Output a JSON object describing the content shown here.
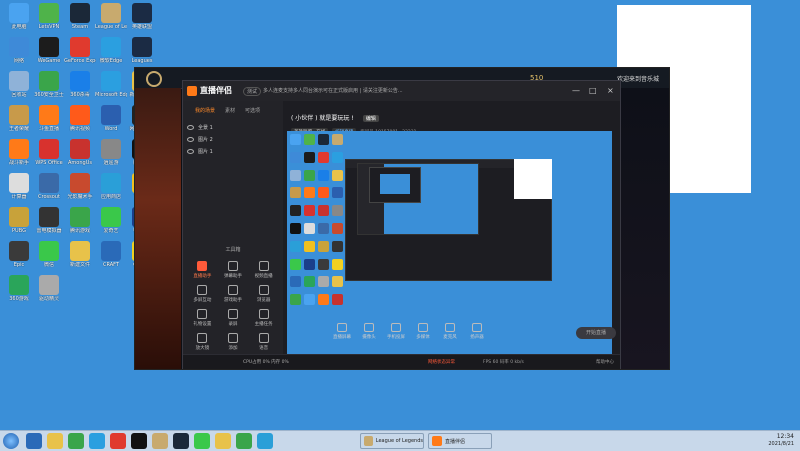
{
  "desktop": {
    "icons": [
      {
        "label": "此电脑",
        "color": "#4aa3f0"
      },
      {
        "label": "LetsVPN",
        "color": "#4fb34a"
      },
      {
        "label": "Steam",
        "color": "#1b2838"
      },
      {
        "label": "League of Legends",
        "color": "#c8aa6e"
      },
      {
        "label": "英雄联盟",
        "color": "#1b2b44"
      },
      {
        "label": "网络",
        "color": "#3e8ad8"
      },
      {
        "label": "WeGame",
        "color": "#1c1c1c"
      },
      {
        "label": "GeForce Experience",
        "color": "#e03a2e"
      },
      {
        "label": "微软Edge",
        "color": "#2b9fe0"
      },
      {
        "label": "Leagues",
        "color": "#1b2b44"
      },
      {
        "label": "回收站",
        "color": "#8fb2d8"
      },
      {
        "label": "360安全卫士",
        "color": "#3aa54a"
      },
      {
        "label": "360杀毒",
        "color": "#1a7fe8"
      },
      {
        "label": "Microsoft Edge",
        "color": "#2b9fe0"
      },
      {
        "label": "新建文件夹",
        "color": "#e8c24a"
      },
      {
        "label": "王者荣耀",
        "color": "#c89a4a"
      },
      {
        "label": "斗鱼直播",
        "color": "#ff7a18"
      },
      {
        "label": "腾讯视频",
        "color": "#ff5a1a"
      },
      {
        "label": "Word",
        "color": "#2b5faf"
      },
      {
        "label": "网易云游戏",
        "color": "#222222"
      },
      {
        "label": "战斗新手",
        "color": "#ff7a18"
      },
      {
        "label": "WPS Office",
        "color": "#d8322e"
      },
      {
        "label": "AmongUs",
        "color": "#c8322e"
      },
      {
        "label": "逍遥游",
        "color": "#888888"
      },
      {
        "label": "腾讯QQ",
        "color": "#111111"
      },
      {
        "label": "计算器",
        "color": "#dddddd"
      },
      {
        "label": "Crossout",
        "color": "#3a6aa8"
      },
      {
        "label": "光影魔术手",
        "color": "#c84a2e"
      },
      {
        "label": "应用商店",
        "color": "#2a9fd8"
      },
      {
        "label": "YY直播",
        "color": "#f0c020"
      },
      {
        "label": "PUBG",
        "color": "#c8a23a"
      },
      {
        "label": "雷电模拟器",
        "color": "#333333"
      },
      {
        "label": "腾讯游戏",
        "color": "#3aa54a"
      },
      {
        "label": "爱奇艺",
        "color": "#3ac84a"
      },
      {
        "label": "Ubisoft",
        "color": "#1a3f8a"
      },
      {
        "label": "Epic",
        "color": "#3a3a3a"
      },
      {
        "label": "微信",
        "color": "#3ac84a"
      },
      {
        "label": "新建文件",
        "color": "#e8c24a"
      },
      {
        "label": "CRAFT",
        "color": "#2a6ab8"
      },
      {
        "label": "QQ音乐",
        "color": "#f0d020"
      },
      {
        "label": "360游戏",
        "color": "#2aa55a"
      },
      {
        "label": "驱动精灵",
        "color": "#aaaaaa"
      }
    ]
  },
  "game_window": {
    "gold_value": "510",
    "right_label": "欢迎来到音乐城"
  },
  "app": {
    "brand": "直播伴侣",
    "beta_label": "测试",
    "notice": "多人连麦支持多人同台演示可在正式版启用 | 请关注更新公告...",
    "window_controls": {
      "min": "—",
      "max": "□",
      "close": "×"
    },
    "left_tabs": [
      {
        "label": "我的场景",
        "active": true
      },
      {
        "label": "素材",
        "active": false
      },
      {
        "label": "可选项",
        "active": false
      }
    ],
    "scenes": [
      {
        "label": "全景 1"
      },
      {
        "label": "图片 2"
      },
      {
        "label": "图片 1"
      }
    ],
    "toolbox_title": "工具箱",
    "tools": [
      {
        "label": "直播助手",
        "hot": true
      },
      {
        "label": "弹幕助手",
        "hot": false
      },
      {
        "label": "视频直播",
        "hot": false
      },
      {
        "label": "多屏互动",
        "hot": false
      },
      {
        "label": "游戏助手",
        "hot": false
      },
      {
        "label": "浏览器",
        "hot": false
      },
      {
        "label": "礼物设置",
        "hot": false
      },
      {
        "label": "录屏",
        "hot": false
      },
      {
        "label": "主播任务",
        "hot": false
      },
      {
        "label": "放大镜",
        "hot": false
      },
      {
        "label": "添加",
        "hot": false
      },
      {
        "label": "语音",
        "hot": false
      }
    ],
    "room": {
      "title": "( 小伙伴 ) 就是要玩玩 !",
      "tag": "编辑",
      "pills": [
        {
          "label": "英雄联盟 · 在线",
          "blue": false
        },
        {
          "label": "编辑直播",
          "blue": true
        }
      ],
      "meta": "房间号 10157081",
      "viewers": "23231"
    },
    "controls": [
      {
        "label": "直播屏幕"
      },
      {
        "label": "摄像头"
      },
      {
        "label": "手机投屏"
      },
      {
        "label": "多媒体"
      },
      {
        "label": "麦克风"
      },
      {
        "label": "扬声器"
      }
    ],
    "start_label": "开始直播",
    "status": {
      "left": "CPU占用 0%  内存 0%",
      "warning": "网络状态异常",
      "fps": "FPS 60",
      "bitrate": "码率 0 kb/s",
      "right": "帮助中心"
    },
    "preview_colors": [
      "#4aa3f0",
      "#4fb34a",
      "#1b2838",
      "#c8aa6e",
      "#3e8ad8",
      "#1c1c1c",
      "#e03a2e",
      "#2b9fe0",
      "#8fb2d8",
      "#3aa54a",
      "#1a7fe8",
      "#e8c24a",
      "#c89a4a",
      "#ff7a18",
      "#ff5a1a",
      "#2b5faf",
      "#222222",
      "#d8322e",
      "#c8322e",
      "#888888",
      "#111111",
      "#dddddd",
      "#3a6aa8",
      "#c84a2e",
      "#2a9fd8",
      "#f0c020",
      "#c8a23a",
      "#333333",
      "#3ac84a",
      "#1a3f8a",
      "#3a3a3a",
      "#f0d020",
      "#2a6ab8",
      "#2aa55a",
      "#aaaaaa",
      "#e8c24a",
      "#3aa54a",
      "#4aa3f0",
      "#ff7a18",
      "#c8322e"
    ]
  },
  "taskbar": {
    "pinned_colors": [
      "#2a6ab8",
      "#e8c24a",
      "#3aa54a",
      "#2b9fe0",
      "#e03a2e",
      "#111111",
      "#c8aa6e",
      "#1b2838",
      "#3ac84a",
      "#e8c24a",
      "#3aa54a",
      "#2a9fd8"
    ],
    "tasks": [
      {
        "label": "League of Legends",
        "color": "#c8aa6e"
      },
      {
        "label": "直播伴侣",
        "color": "#ff7a18"
      }
    ],
    "time": "12:34",
    "date": "2021/8/21"
  }
}
